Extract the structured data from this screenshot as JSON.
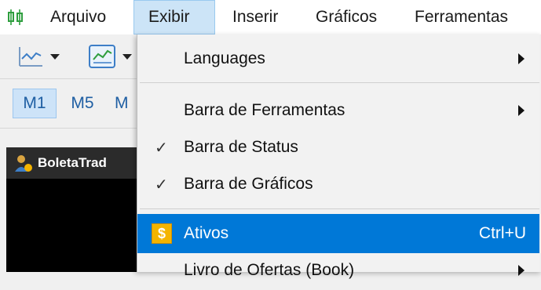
{
  "menubar": {
    "items": [
      {
        "label": "Arquivo"
      },
      {
        "label": "Exibir"
      },
      {
        "label": "Inserir"
      },
      {
        "label": "Gráficos"
      },
      {
        "label": "Ferramentas"
      }
    ],
    "active_item": "Exibir"
  },
  "timeframes": [
    {
      "label": "M1",
      "selected": true
    },
    {
      "label": "M5",
      "selected": false
    },
    {
      "label": "M",
      "selected": false
    }
  ],
  "panel": {
    "title": "BoletaTrad"
  },
  "dropdown": {
    "items": [
      {
        "label": "Languages",
        "submenu": true
      },
      {
        "label": "Barra de Ferramentas",
        "submenu": true
      },
      {
        "label": "Barra de Status",
        "checked": true
      },
      {
        "label": "Barra de Gráficos",
        "checked": true
      },
      {
        "label": "Ativos",
        "shortcut": "Ctrl+U",
        "icon": "dollar-icon",
        "highlighted": true
      },
      {
        "label": "Livro de Ofertas (Book)",
        "submenu": true
      }
    ],
    "check_glyph": "✓",
    "dollar_glyph": "$"
  },
  "colors": {
    "highlight": "#0078d7",
    "menu_active": "#cce4f7",
    "timeframe_text": "#1f5fa3",
    "chart_bg": "#000000"
  }
}
